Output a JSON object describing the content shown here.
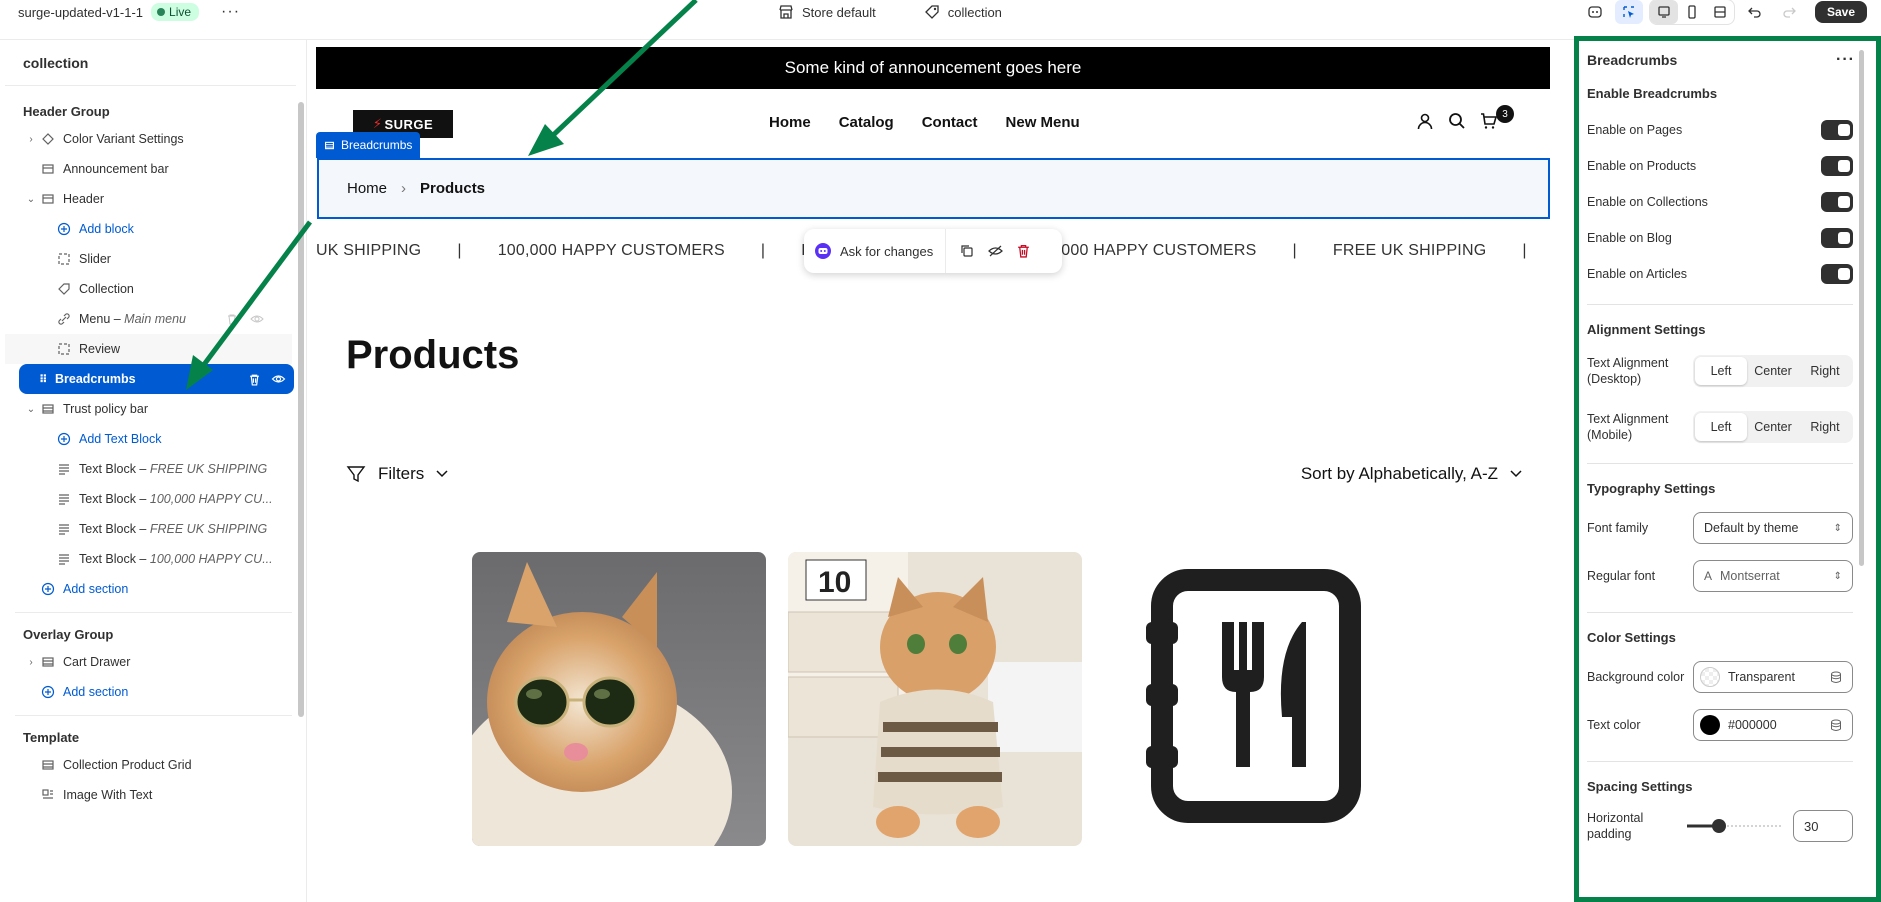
{
  "topbar": {
    "store_name": "surge-updated-v1-1-1",
    "status_badge": "Live",
    "more": "···",
    "store_default": "Store default",
    "template": "collection",
    "save_label": "Save"
  },
  "sidebar": {
    "title": "collection",
    "header_group": {
      "title": "Header Group",
      "items": [
        {
          "label": "Color Variant Settings"
        },
        {
          "label": "Announcement bar"
        },
        {
          "label": "Header"
        },
        {
          "label": "Add block"
        },
        {
          "label": "Slider"
        },
        {
          "label": "Collection"
        },
        {
          "label": "Menu – ",
          "sub": "Main menu"
        },
        {
          "label": "Review"
        },
        {
          "label": "Breadcrumbs"
        },
        {
          "label": "Trust policy bar"
        },
        {
          "label": "Add Text Block"
        },
        {
          "label": "Text Block – ",
          "sub": "FREE UK SHIPPING"
        },
        {
          "label": "Text Block – ",
          "sub": "100,000 HAPPY CU..."
        },
        {
          "label": "Text Block – ",
          "sub": "FREE UK SHIPPING"
        },
        {
          "label": "Text Block – ",
          "sub": "100,000 HAPPY CU..."
        },
        {
          "label": "Add section"
        }
      ]
    },
    "overlay_group": {
      "title": "Overlay Group",
      "items": [
        {
          "label": "Cart Drawer"
        },
        {
          "label": "Add section"
        }
      ]
    },
    "template_group": {
      "title": "Template",
      "items": [
        {
          "label": "Collection Product Grid"
        },
        {
          "label": "Image With Text"
        }
      ]
    }
  },
  "preview": {
    "announcement": "Some kind of announcement goes here",
    "logo": "SURGE",
    "nav": [
      "Home",
      "Catalog",
      "Contact",
      "New Menu"
    ],
    "cart_count": "3",
    "selected_tag": "Breadcrumbs",
    "breadcrumb": {
      "home": "Home",
      "sep": "›",
      "current": "Products"
    },
    "ticker": [
      "UK SHIPPING",
      "|",
      "100,000 HAPPY CUSTOMERS",
      "|",
      "F",
      "000 HAPPY CUSTOMERS",
      "|",
      "FREE UK SHIPPING",
      "|"
    ],
    "ask_for_changes": "Ask for changes",
    "page_title": "Products",
    "filters": "Filters",
    "sort": "Sort by Alphabetically, A-Z"
  },
  "settings": {
    "title": "Breadcrumbs",
    "enable_title": "Enable Breadcrumbs",
    "toggles": [
      {
        "label": "Enable on Pages",
        "on": true
      },
      {
        "label": "Enable on Products",
        "on": true
      },
      {
        "label": "Enable on Collections",
        "on": true
      },
      {
        "label": "Enable on Blog",
        "on": true
      },
      {
        "label": "Enable on Articles",
        "on": true
      }
    ],
    "alignment": {
      "title": "Alignment Settings",
      "desktop_label": "Text Alignment (Desktop)",
      "mobile_label": "Text Alignment (Mobile)",
      "options": [
        "Left",
        "Center",
        "Right"
      ],
      "desktop_value": "Left",
      "mobile_value": "Left"
    },
    "typography": {
      "title": "Typography Settings",
      "font_family_label": "Font family",
      "font_family_value": "Default by theme",
      "regular_font_label": "Regular font",
      "regular_font_value": "Montserrat"
    },
    "colors": {
      "title": "Color Settings",
      "bg_label": "Background color",
      "bg_value": "Transparent",
      "text_label": "Text color",
      "text_value": "#000000"
    },
    "spacing": {
      "title": "Spacing Settings",
      "h_padding_label": "Horizontal padding",
      "h_padding_value": "30"
    }
  },
  "colors": {
    "accent": "#005bd3",
    "annotation": "#058249",
    "live_bg": "#cdfee1"
  }
}
